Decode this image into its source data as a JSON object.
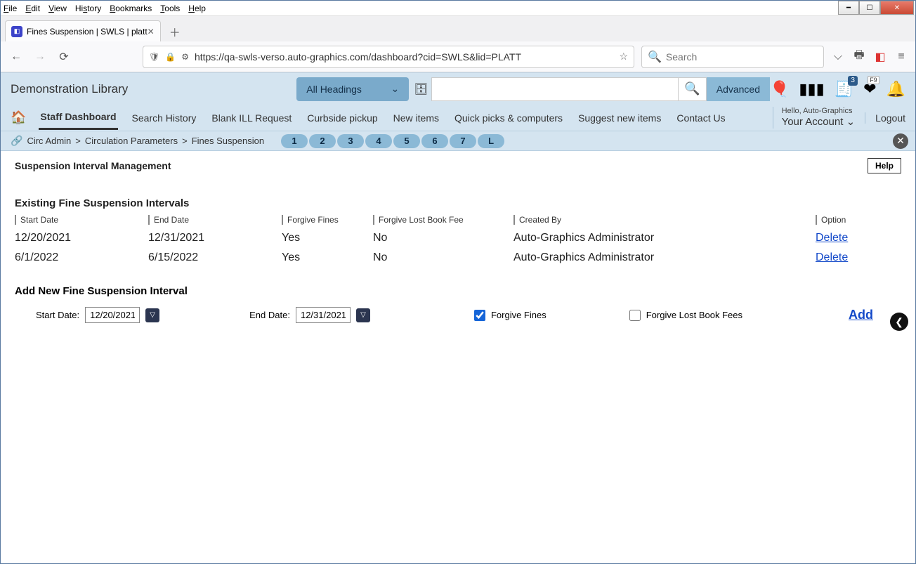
{
  "browser": {
    "menus": [
      "File",
      "Edit",
      "View",
      "History",
      "Bookmarks",
      "Tools",
      "Help"
    ],
    "tab_title": "Fines Suspension | SWLS | platt",
    "url": "https://qa-swls-verso.auto-graphics.com/dashboard?cid=SWLS&lid=PLATT",
    "search_placeholder": "Search"
  },
  "header": {
    "library": "Demonstration Library",
    "heading_dd": "All Headings",
    "advanced": "Advanced",
    "receipt_badge": "3",
    "fav_badge": "F9"
  },
  "nav": {
    "items": [
      "Staff Dashboard",
      "Search History",
      "Blank ILL Request",
      "Curbside pickup",
      "New items",
      "Quick picks & computers",
      "Suggest new items",
      "Contact Us"
    ],
    "hello": "Hello, Auto-Graphics",
    "your": "Your Account",
    "logout": "Logout"
  },
  "crumb": {
    "parts": [
      "Circ Admin",
      "Circulation Parameters",
      "Fines Suspension"
    ],
    "pager": [
      "1",
      "2",
      "3",
      "4",
      "5",
      "6",
      "7",
      "L"
    ]
  },
  "page": {
    "title": "Suspension Interval Management",
    "help": "Help",
    "existing_h": "Existing Fine Suspension Intervals",
    "cols": {
      "start": "Start Date",
      "end": "End Date",
      "ff": "Forgive Fines",
      "flb": "Forgive Lost Book Fee",
      "cb": "Created By",
      "opt": "Option"
    },
    "rows": [
      {
        "start": "12/20/2021",
        "end": "12/31/2021",
        "ff": "Yes",
        "flb": "No",
        "cb": "Auto-Graphics Administrator",
        "opt": "Delete"
      },
      {
        "start": "6/1/2022",
        "end": "6/15/2022",
        "ff": "Yes",
        "flb": "No",
        "cb": "Auto-Graphics Administrator",
        "opt": "Delete"
      }
    ],
    "add_h": "Add New Fine Suspension Interval",
    "start_lbl": "Start Date:",
    "start_val": "12/20/2021",
    "end_lbl": "End Date:",
    "end_val": "12/31/2021",
    "ff_lbl": "Forgive Fines",
    "flb_lbl": "Forgive Lost Book Fees",
    "add_lbl": "Add"
  }
}
